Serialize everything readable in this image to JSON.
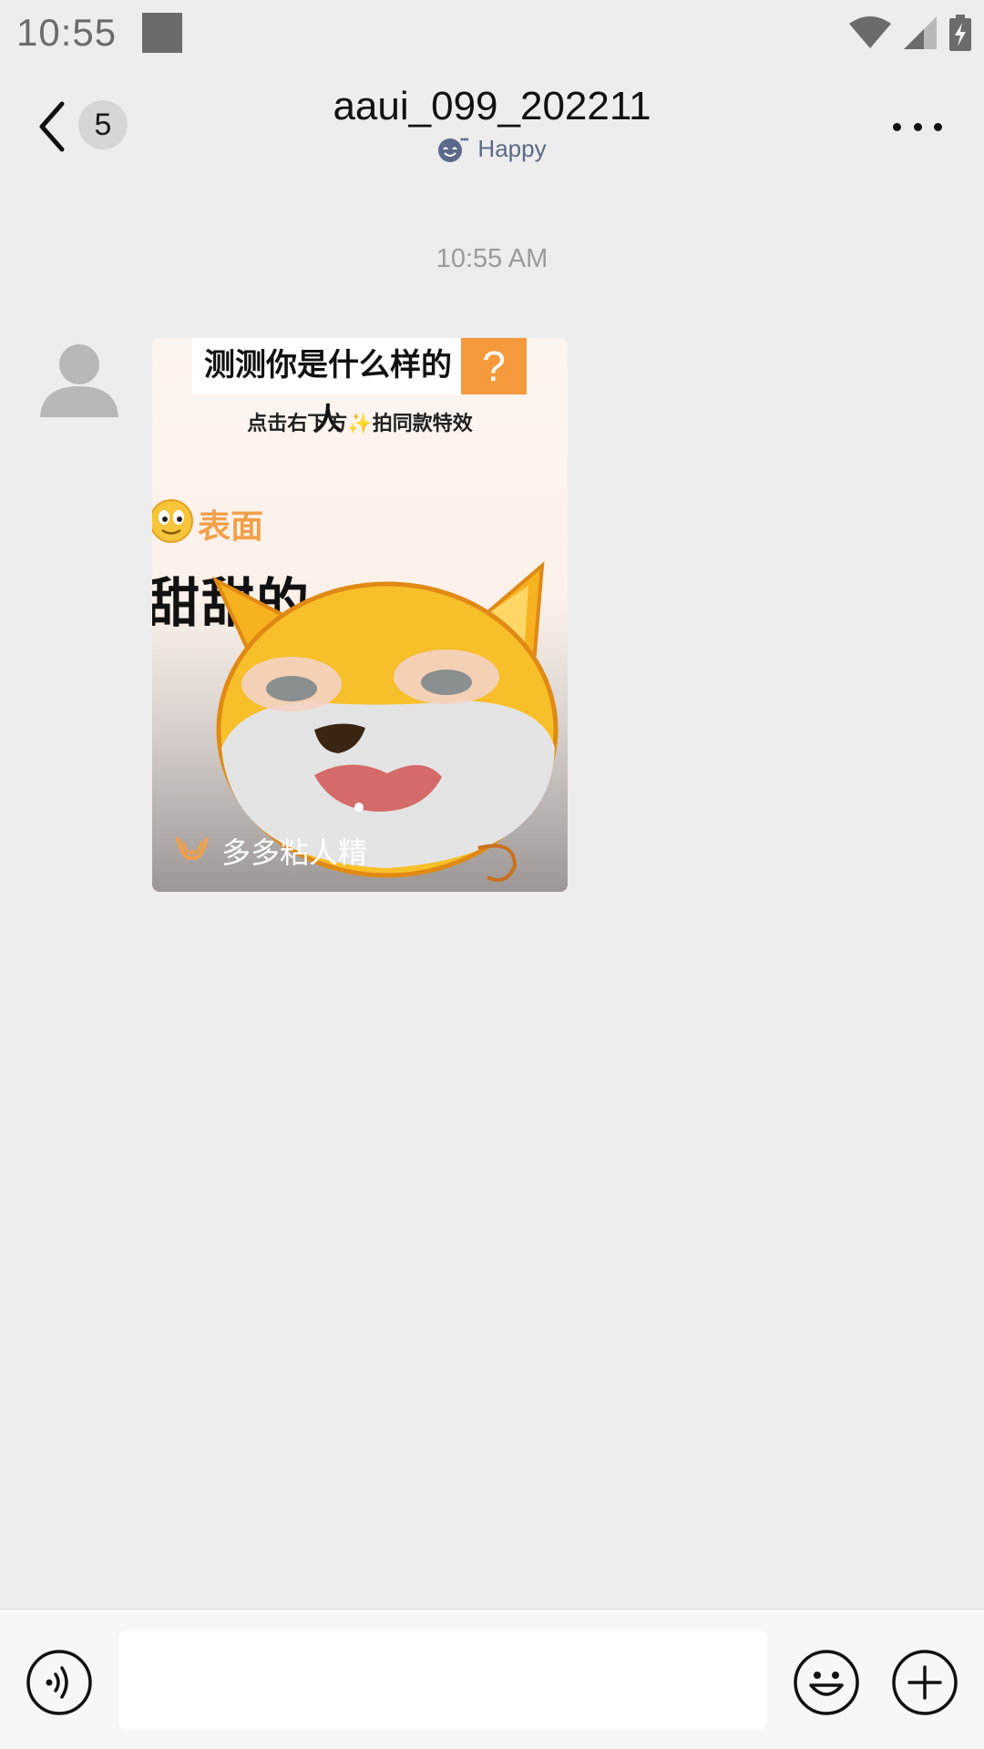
{
  "status_bar": {
    "time": "10:55",
    "icons": [
      "wifi-icon",
      "signal-icon",
      "battery-charging-icon"
    ]
  },
  "header": {
    "unread_count": "5",
    "title": "aaui_099_202211",
    "status_text": "Happy",
    "status_icon": "happy-face-icon"
  },
  "messages": {
    "timestamp": "10:55 AM",
    "video": {
      "title": "测测你是什么样的人",
      "title_mark": "?",
      "subtitle": "点击右下方✨拍同款特效",
      "label": "表面",
      "big_text": "甜甜的",
      "caption": "多多粘人精"
    }
  },
  "input_bar": {
    "placeholder": "",
    "icons": [
      "voice-icon",
      "emoji-icon",
      "plus-icon"
    ]
  },
  "colors": {
    "background": "#ededed",
    "status_text": "#5b6a8a",
    "accent_orange": "#f59a3c"
  }
}
